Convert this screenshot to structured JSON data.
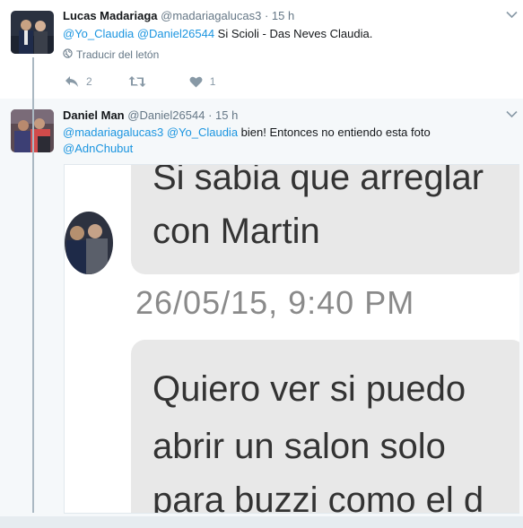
{
  "tweets": [
    {
      "fullname": "Lucas Madariaga",
      "username": "@madariagalucas3",
      "dot": "·",
      "time": "15 h",
      "text_parts": [
        {
          "t": "@Yo_Claudia",
          "mention": true
        },
        {
          "t": " ",
          "mention": false
        },
        {
          "t": "@Daniel26544",
          "mention": true
        },
        {
          "t": " Si Scioli - Das Neves Claudia.",
          "mention": false
        }
      ],
      "translate_label": "Traducir del letón",
      "reply_count": "2",
      "retweet_count": "",
      "like_count": "1"
    },
    {
      "fullname": "Daniel Man",
      "username": "@Daniel26544",
      "dot": "·",
      "time": "15 h",
      "line1": [
        {
          "t": "@madariagalucas3",
          "mention": true
        },
        {
          "t": " ",
          "mention": false
        },
        {
          "t": "@Yo_Claudia",
          "mention": true
        },
        {
          "t": " bien! Entonces no entiendo esta foto",
          "mention": false
        }
      ],
      "line2": [
        {
          "t": "@AdnChubut",
          "mention": true
        }
      ]
    }
  ],
  "media": {
    "bubble1_line1": "Si sabia que arreglar",
    "bubble1_line2": "con Martin",
    "timestamp": "26/05/15, 9:40 PM",
    "bubble2_line1": "Quiero ver si puedo",
    "bubble2_line2": "abrir un salon solo",
    "bubble2_line3": "para buzzi como el d"
  },
  "colors": {
    "link": "#1b95e0",
    "muted": "#657786",
    "thread": "#aab8c2",
    "bubble": "#e8e8e8",
    "background_alt": "#f5f8fa"
  },
  "icons": [
    "reply-icon",
    "retweet-icon",
    "like-icon",
    "globe-icon",
    "chevron-down-icon"
  ]
}
